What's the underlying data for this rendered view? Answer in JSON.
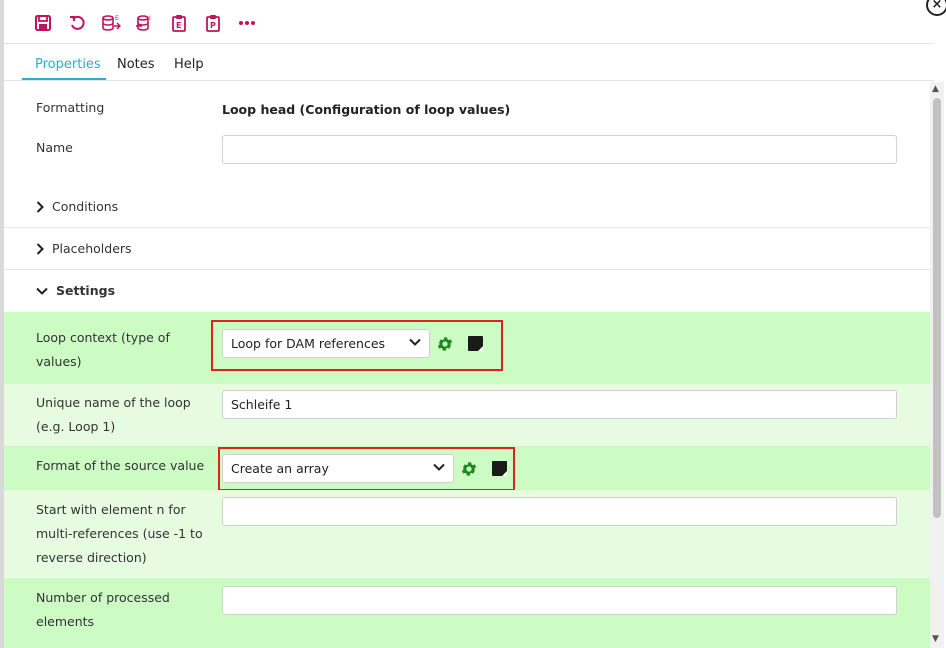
{
  "toolbar": {
    "icons": [
      "save-icon",
      "undo-icon",
      "database-export-icon",
      "database-import-icon",
      "clipboard-e-icon",
      "clipboard-p-icon",
      "more-icon"
    ],
    "icon_color": "#c0135f"
  },
  "tabs": [
    {
      "label": "Properties",
      "active": true
    },
    {
      "label": "Notes",
      "active": false
    },
    {
      "label": "Help",
      "active": false
    }
  ],
  "form": {
    "formatting_label": "Formatting",
    "formatting_value": "Loop head (Configuration of loop values)",
    "name_label": "Name",
    "name_value": ""
  },
  "sections": {
    "conditions": "Conditions",
    "placeholders": "Placeholders",
    "settings": "Settings"
  },
  "settings": {
    "loop_context_label_1": "Loop context (type of",
    "loop_context_label_2": "values)",
    "loop_context_value": "Loop for DAM references",
    "unique_name_label_1": "Unique name of the loop",
    "unique_name_label_2": "(e.g. Loop 1)",
    "unique_name_value": "Schleife 1",
    "format_label": "Format of the source value",
    "format_value": "Create an array",
    "start_label_1": "Start with element n for",
    "start_label_2": "multi-references (use -1 to",
    "start_label_3": "reverse direction)",
    "start_value": "",
    "processed_label_1": "Number of processed",
    "processed_label_2": "elements",
    "processed_value": ""
  },
  "colors": {
    "accent": "#2ab0c9",
    "highlight_green": "#ccfcc4",
    "highlight_green_light": "#e6fbe0",
    "gear_green": "#1a8a1a",
    "annotation_red": "#dd2222"
  },
  "close_label": "×"
}
